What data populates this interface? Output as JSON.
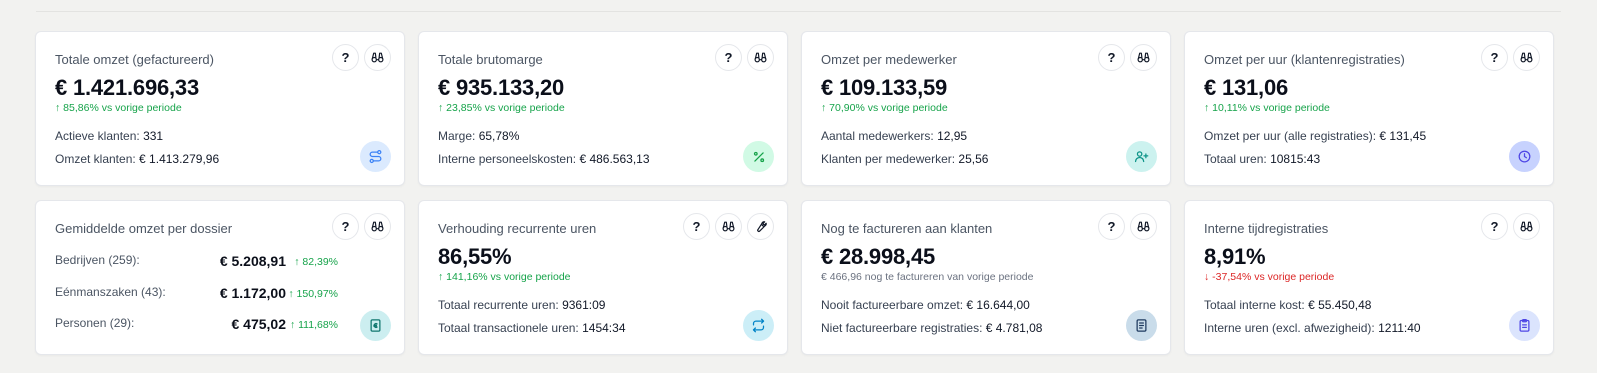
{
  "colors": {
    "positive": "#16a34a",
    "negative": "#dc2626",
    "badge_blue": "#dbeafe",
    "badge_green": "#d1fae5",
    "badge_teal": "#ccf2ef",
    "badge_indigo": "#c7d2fe",
    "badge_cyan": "#cceef7"
  },
  "cards": [
    {
      "title": "Totale omzet (gefactureerd)",
      "value": "€ 1.421.696,33",
      "trend": "↑ 85,86% vs vorige periode",
      "rows": [
        {
          "label": "Actieve klanten:",
          "value": "331"
        },
        {
          "label": "Omzet klanten:",
          "value": "€ 1.413.279,96"
        }
      ],
      "badge_icon": "route-icon"
    },
    {
      "title": "Totale brutomarge",
      "value": "€ 935.133,20",
      "trend": "↑ 23,85% vs vorige periode",
      "rows": [
        {
          "label": "Marge:",
          "value": "65,78%"
        },
        {
          "label": "Interne personeelskosten:",
          "value": "€ 486.563,13"
        }
      ],
      "badge_icon": "percent-icon"
    },
    {
      "title": "Omzet per medewerker",
      "value": "€ 109.133,59",
      "trend": "↑ 70,90% vs vorige periode",
      "rows": [
        {
          "label": "Aantal medewerkers:",
          "value": "12,95"
        },
        {
          "label": "Klanten per medewerker:",
          "value": "25,56"
        }
      ],
      "badge_icon": "user-plus-icon"
    },
    {
      "title": "Omzet per uur (klantenregistraties)",
      "value": "€ 131,06",
      "trend": "↑ 10,11% vs vorige periode",
      "rows": [
        {
          "label": "Omzet per uur (alle registraties):",
          "value": "€ 131,45"
        },
        {
          "label": "Totaal uren:",
          "value": "10815:43"
        }
      ],
      "badge_icon": "clock-icon"
    },
    {
      "title": "Gemiddelde omzet per dossier",
      "dossiers": [
        {
          "label": "Bedrijven (259):",
          "amount": "€ 5.208,91",
          "trend": "↑ 82,39%"
        },
        {
          "label": "Eénmanszaken (43):",
          "amount": "€ 1.172,00",
          "trend": "↑ 150,97%"
        },
        {
          "label": "Personen (29):",
          "amount": "€ 475,02",
          "trend": "↑ 111,68%"
        }
      ],
      "badge_icon": "euro-document-icon"
    },
    {
      "title": "Verhouding recurrente uren",
      "value": "86,55%",
      "trend": "↑ 141,16% vs vorige periode",
      "rows": [
        {
          "label": "Totaal recurrente uren:",
          "value": "9361:09"
        },
        {
          "label": "Totaal transactionele uren:",
          "value": "1454:34"
        }
      ],
      "badge_icon": "repeat-icon"
    },
    {
      "title": "Nog te factureren aan klanten",
      "value": "€ 28.998,45",
      "trend": "€ 466,96 nog te factureren van vorige periode",
      "rows": [
        {
          "label": "Nooit factureerbare omzet:",
          "value": "€ 16.644,00"
        },
        {
          "label": "Niet factureerbare registraties:",
          "value": "€ 4.781,08"
        }
      ],
      "badge_icon": "file-text-icon"
    },
    {
      "title": "Interne tijdregistraties",
      "value": "8,91%",
      "trend": "↓ -37,54% vs vorige periode",
      "rows": [
        {
          "label": "Totaal interne kost:",
          "value": "€ 55.450,48"
        },
        {
          "label": "Interne uren (excl. afwezigheid):",
          "value": "1211:40"
        }
      ],
      "badge_icon": "clipboard-icon"
    }
  ],
  "actions": {
    "help": "?",
    "help_icon": "help-icon",
    "explore_icon": "binoculars-icon",
    "settings_icon": "wrench-icon"
  }
}
